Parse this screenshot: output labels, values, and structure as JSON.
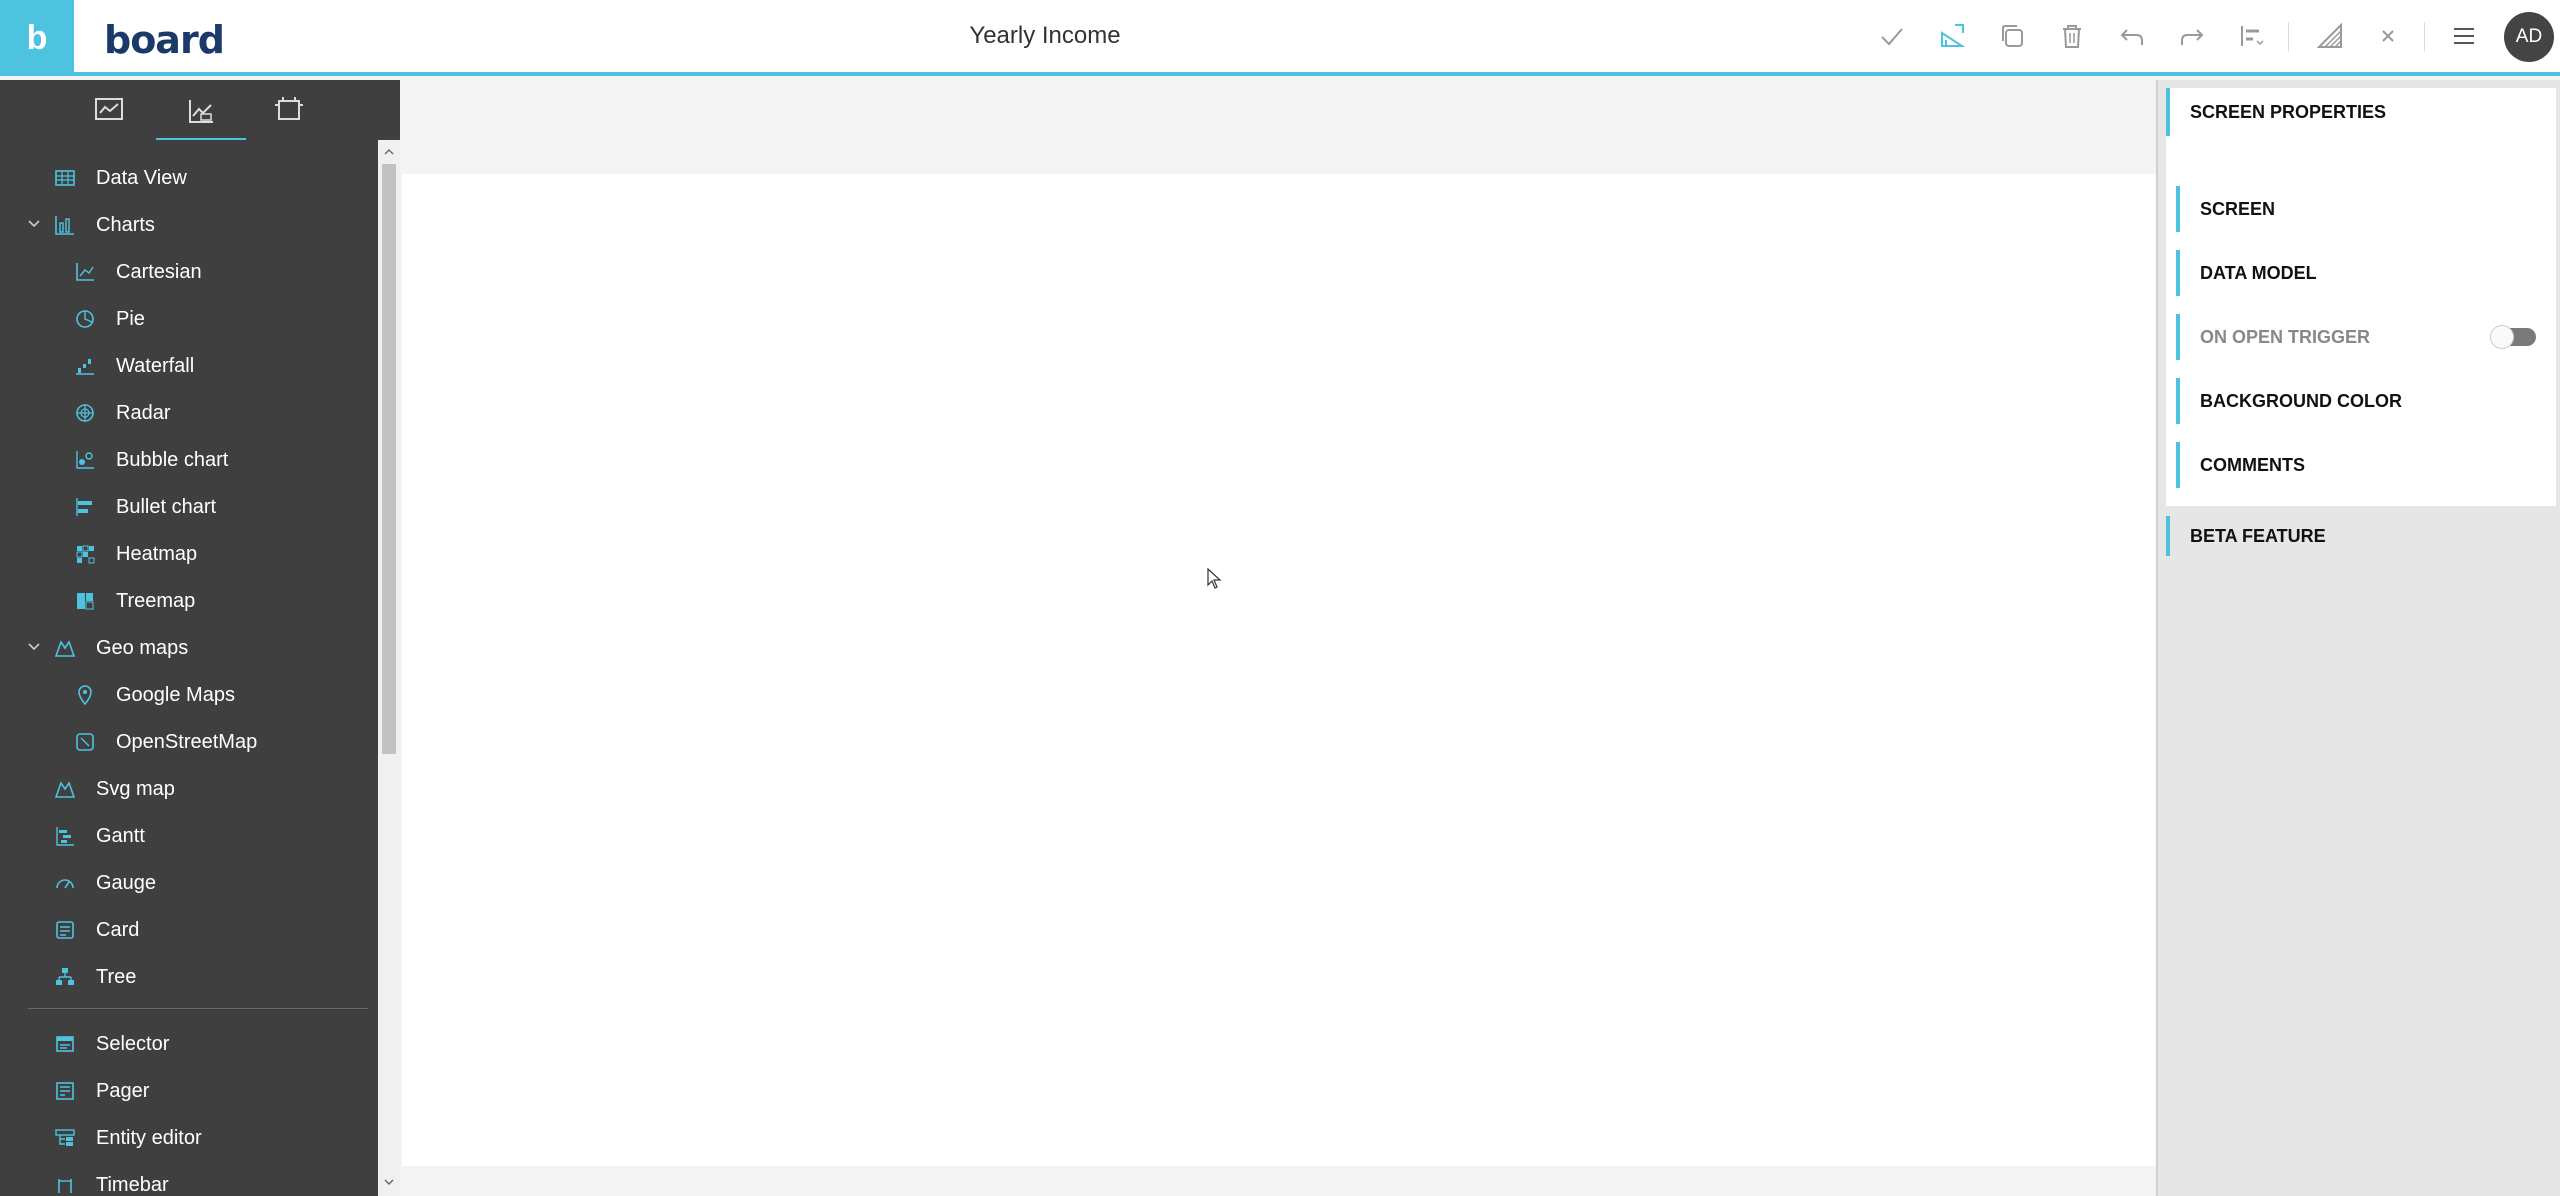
{
  "app": {
    "brand_letter": "b",
    "logo_main": "board",
    "title": "Yearly Income"
  },
  "toolbar": {
    "icons": [
      "check-icon",
      "layout-edit-icon",
      "copy-icon",
      "trash-icon",
      "undo-icon",
      "redo-icon",
      "align-icon",
      "pencil-ruler-icon",
      "close-icon",
      "menu-icon"
    ],
    "avatar_initials": "AD"
  },
  "sidebar": {
    "tabs": [
      "screen-tab",
      "objects-tab",
      "layout-tab"
    ],
    "items": [
      {
        "label": "Data View"
      },
      {
        "label": "Charts"
      },
      {
        "label": "Cartesian"
      },
      {
        "label": "Pie"
      },
      {
        "label": "Waterfall"
      },
      {
        "label": "Radar"
      },
      {
        "label": "Bubble chart"
      },
      {
        "label": "Bullet chart"
      },
      {
        "label": "Heatmap"
      },
      {
        "label": "Treemap"
      },
      {
        "label": "Geo maps"
      },
      {
        "label": "Google Maps"
      },
      {
        "label": "OpenStreetMap"
      },
      {
        "label": "Svg map"
      },
      {
        "label": "Gantt"
      },
      {
        "label": "Gauge"
      },
      {
        "label": "Card"
      },
      {
        "label": "Tree"
      },
      {
        "label": "Selector"
      },
      {
        "label": "Pager"
      },
      {
        "label": "Entity editor"
      },
      {
        "label": "Timebar"
      }
    ]
  },
  "panel": {
    "header": "SCREEN PROPERTIES",
    "items": [
      {
        "label": "SCREEN"
      },
      {
        "label": "DATA MODEL"
      },
      {
        "label": "ON OPEN TRIGGER"
      },
      {
        "label": "BACKGROUND COLOR"
      },
      {
        "label": "COMMENTS"
      }
    ],
    "beta": "BETA FEATURE"
  },
  "colors": {
    "accent": "#4ec3e0",
    "sidebar_bg": "#3f3f3f",
    "logo": "#1b3a67"
  }
}
